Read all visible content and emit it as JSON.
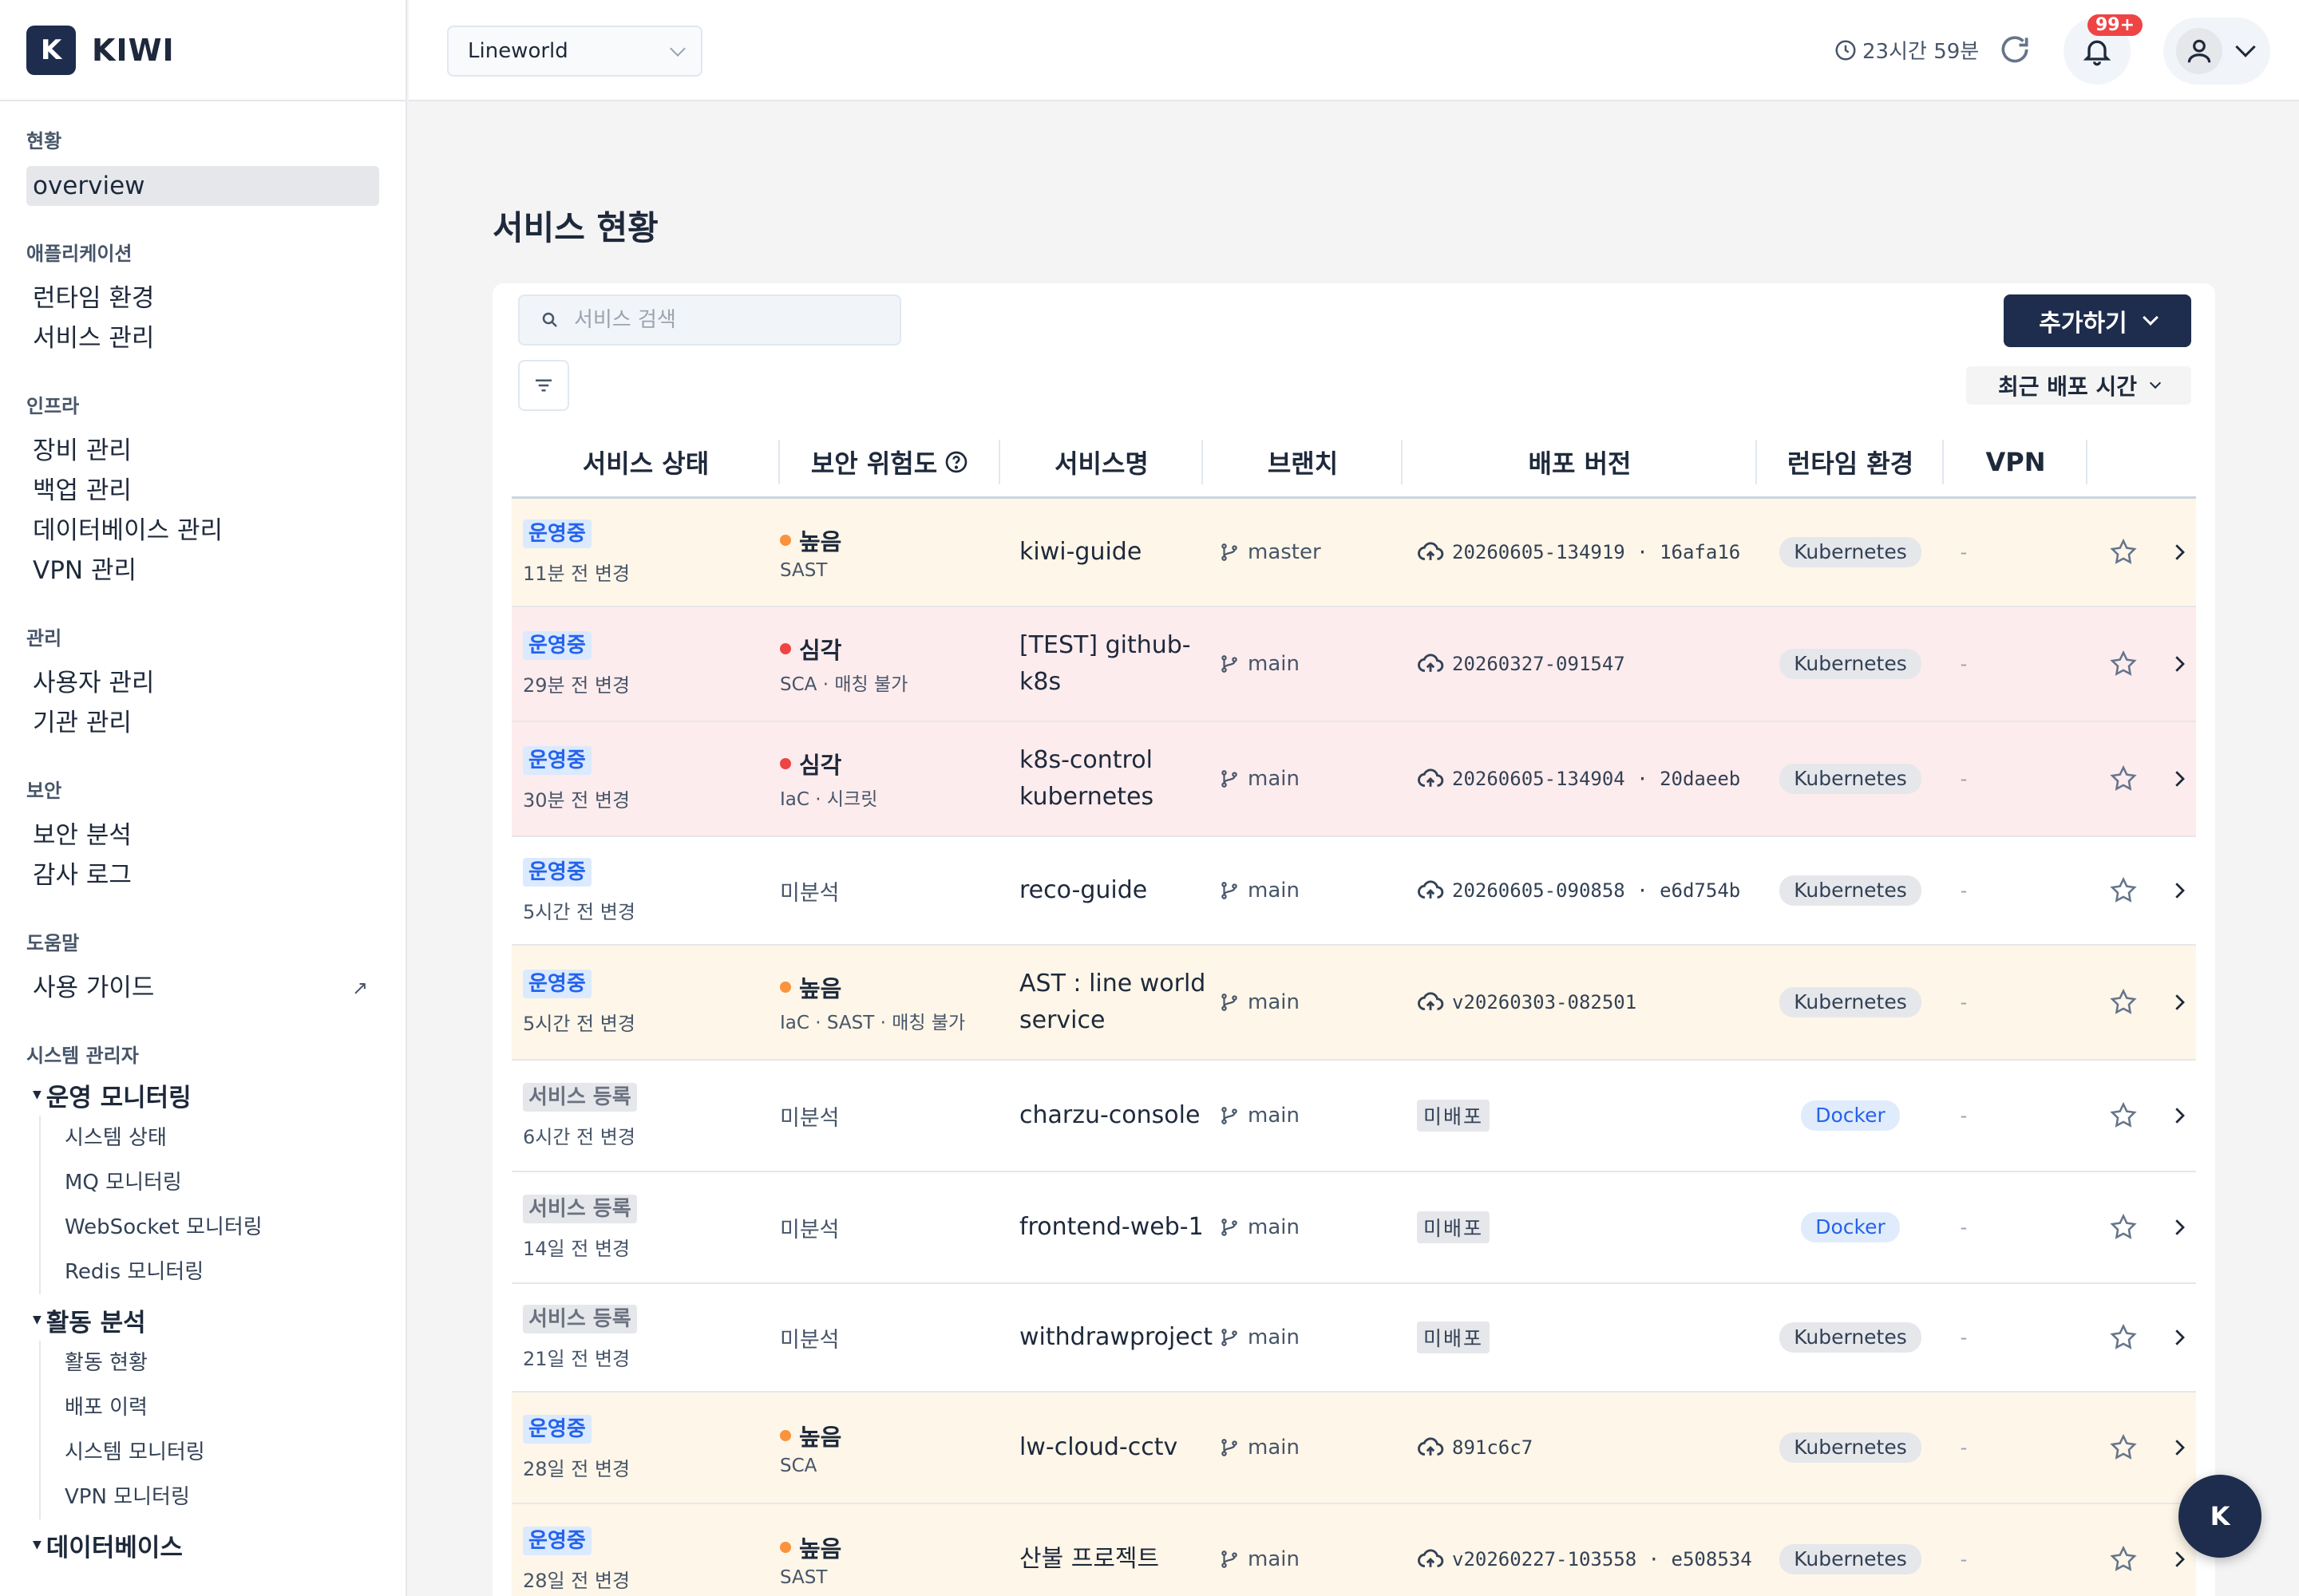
{
  "app": {
    "logo_letter": "K",
    "name": "KIWI"
  },
  "sidebar": {
    "groups": [
      {
        "title": "현황",
        "items": [
          "overview"
        ]
      },
      {
        "title": "애플리케이션",
        "items": [
          "런타임 환경",
          "서비스 관리"
        ]
      },
      {
        "title": "인프라",
        "items": [
          "장비 관리",
          "백업 관리",
          "데이터베이스 관리",
          "VPN 관리"
        ]
      },
      {
        "title": "관리",
        "items": [
          "사용자 관리",
          "기관 관리"
        ]
      },
      {
        "title": "보안",
        "items": [
          "보안 분석",
          "감사 로그"
        ]
      },
      {
        "title": "도움말",
        "items": [
          "사용 가이드"
        ],
        "ext_icon": "↗"
      }
    ],
    "admin": {
      "title": "시스템 관리자",
      "trees": [
        {
          "label": "운영 모니터링",
          "children": [
            "시스템 상태",
            "MQ 모니터링",
            "WebSocket 모니터링",
            "Redis 모니터링"
          ]
        },
        {
          "label": "활동 분석",
          "children": [
            "활동 현황",
            "배포 이력",
            "시스템 모니터링",
            "VPN 모니터링"
          ]
        },
        {
          "label": "데이터베이스",
          "children": []
        }
      ]
    }
  },
  "topbar": {
    "project": "Lineworld",
    "session_time": "23시간 59분",
    "notification_badge": "99+"
  },
  "main": {
    "title": "서비스 현황",
    "search_placeholder": "서비스 검색",
    "add_button": "추가하기",
    "sort_label": "최근 배포 시간",
    "columns": [
      "서비스 상태",
      "보안 위험도",
      "서비스명",
      "브랜치",
      "배포 버전",
      "런타임 환경",
      "VPN"
    ],
    "rows": [
      {
        "status": "운영중",
        "status_type": "run",
        "changed": "11분 전 변경",
        "sev": "높음",
        "sev_type": "orange",
        "sec_sub": "SAST",
        "name": [
          "kiwi-guide"
        ],
        "branch": "master",
        "version": "20260605-134919 · 16afa16",
        "deployed": true,
        "runtime": "Kubernetes",
        "runtime_type": "k8s",
        "vpn": "-",
        "bg": "warn"
      },
      {
        "status": "운영중",
        "status_type": "run",
        "changed": "29분 전 변경",
        "sev": "심각",
        "sev_type": "red",
        "sec_sub": "SCA · 매칭 불가",
        "name": [
          "[TEST] github-",
          "k8s"
        ],
        "branch": "main",
        "version": "20260327-091547",
        "deployed": true,
        "runtime": "Kubernetes",
        "runtime_type": "k8s",
        "vpn": "-",
        "bg": "crit"
      },
      {
        "status": "운영중",
        "status_type": "run",
        "changed": "30분 전 변경",
        "sev": "심각",
        "sev_type": "red",
        "sec_sub": "IaC · 시크릿",
        "name": [
          "k8s-control",
          "kubernetes"
        ],
        "branch": "main",
        "version": "20260605-134904 · 20daeeb",
        "deployed": true,
        "runtime": "Kubernetes",
        "runtime_type": "k8s",
        "vpn": "-",
        "bg": "crit"
      },
      {
        "status": "운영중",
        "status_type": "run",
        "changed": "5시간 전 변경",
        "sev": "미분석",
        "sev_type": "none",
        "sec_sub": "",
        "name": [
          "reco-guide"
        ],
        "branch": "main",
        "version": "20260605-090858 · e6d754b",
        "deployed": true,
        "runtime": "Kubernetes",
        "runtime_type": "k8s",
        "vpn": "-",
        "bg": "none"
      },
      {
        "status": "운영중",
        "status_type": "run",
        "changed": "5시간 전 변경",
        "sev": "높음",
        "sev_type": "orange",
        "sec_sub": "IaC · SAST · 매칭 불가",
        "name": [
          "AST : line world",
          "service"
        ],
        "branch": "main",
        "version": "v20260303-082501",
        "deployed": true,
        "runtime": "Kubernetes",
        "runtime_type": "k8s",
        "vpn": "-",
        "bg": "warn"
      },
      {
        "status": "서비스 등록",
        "status_type": "reg",
        "changed": "6시간 전 변경",
        "sev": "미분석",
        "sev_type": "none",
        "sec_sub": "",
        "name": [
          "charzu-console"
        ],
        "branch": "main",
        "version": "미배포",
        "deployed": false,
        "runtime": "Docker",
        "runtime_type": "docker",
        "vpn": "-",
        "bg": "none"
      },
      {
        "status": "서비스 등록",
        "status_type": "reg",
        "changed": "14일 전 변경",
        "sev": "미분석",
        "sev_type": "none",
        "sec_sub": "",
        "name": [
          "frontend-web-1"
        ],
        "branch": "main",
        "version": "미배포",
        "deployed": false,
        "runtime": "Docker",
        "runtime_type": "docker",
        "vpn": "-",
        "bg": "none"
      },
      {
        "status": "서비스 등록",
        "status_type": "reg",
        "changed": "21일 전 변경",
        "sev": "미분석",
        "sev_type": "none",
        "sec_sub": "",
        "name": [
          "withdrawproject"
        ],
        "branch": "main",
        "version": "미배포",
        "deployed": false,
        "runtime": "Kubernetes",
        "runtime_type": "k8s",
        "vpn": "-",
        "bg": "none"
      },
      {
        "status": "운영중",
        "status_type": "run",
        "changed": "28일 전 변경",
        "sev": "높음",
        "sev_type": "orange",
        "sec_sub": "SCA",
        "name": [
          "lw-cloud-cctv"
        ],
        "branch": "main",
        "version": "891c6c7",
        "deployed": true,
        "runtime": "Kubernetes",
        "runtime_type": "k8s",
        "vpn": "-",
        "bg": "warn"
      },
      {
        "status": "운영중",
        "status_type": "run",
        "changed": "28일 전 변경",
        "sev": "높음",
        "sev_type": "orange",
        "sec_sub": "SAST",
        "name": [
          "산불 프로젝트"
        ],
        "branch": "main",
        "version": "v20260227-103558 · e508534",
        "deployed": true,
        "runtime": "Kubernetes",
        "runtime_type": "k8s",
        "vpn": "-",
        "bg": "warn"
      }
    ]
  },
  "fab_letter": "K"
}
